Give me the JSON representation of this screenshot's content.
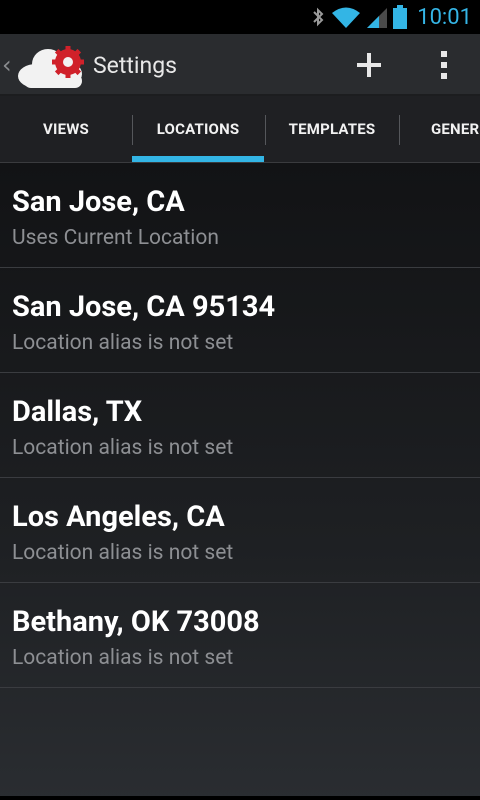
{
  "status_bar": {
    "time": "10:01",
    "icons": [
      "bluetooth-icon",
      "wifi-icon",
      "signal-icon",
      "battery-icon"
    ],
    "accent_color": "#33b5e5"
  },
  "action_bar": {
    "title": "Settings",
    "icons": [
      "back-chevron-icon",
      "app-cloud-gear-icon",
      "add-icon",
      "overflow-menu-icon"
    ]
  },
  "tabs": [
    {
      "label": "VIEWS",
      "selected": false
    },
    {
      "label": "LOCATIONS",
      "selected": true
    },
    {
      "label": "TEMPLATES",
      "selected": false
    },
    {
      "label": "GENER",
      "selected": false
    }
  ],
  "locations": [
    {
      "name": "San Jose, CA",
      "detail": "Uses Current Location"
    },
    {
      "name": "San Jose, CA 95134",
      "detail": "Location alias is not set"
    },
    {
      "name": "Dallas, TX",
      "detail": "Location alias is not set"
    },
    {
      "name": "Los Angeles, CA",
      "detail": "Location alias is not set"
    },
    {
      "name": "Bethany, OK 73008",
      "detail": "Location alias is not set"
    }
  ]
}
